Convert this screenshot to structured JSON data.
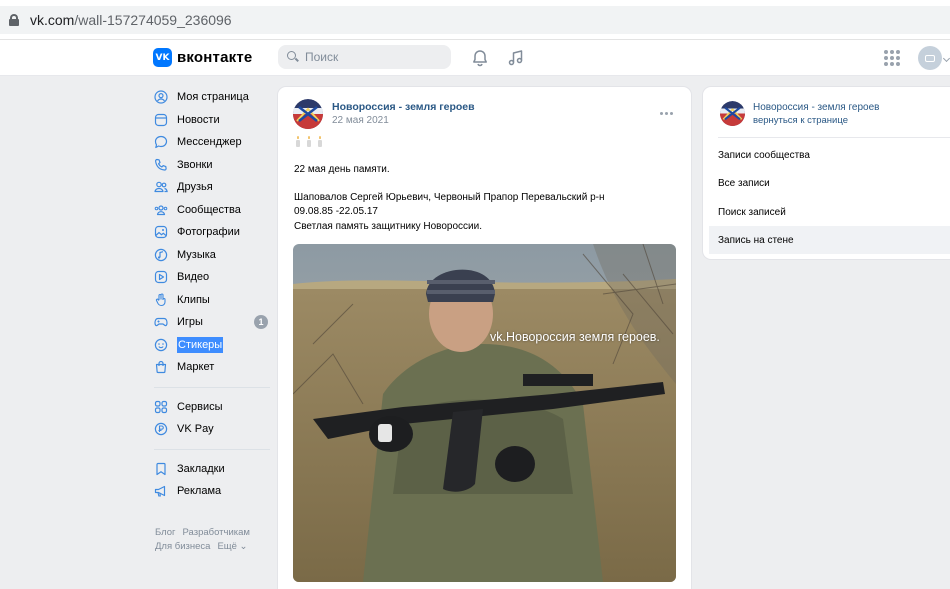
{
  "browser": {
    "url_host": "vk.com",
    "url_path": "/wall-157274059_236096"
  },
  "header": {
    "logo_mark": "VK",
    "logo_text": "вконтакте",
    "search_placeholder": "Поиск"
  },
  "sidebar": {
    "items": [
      {
        "label": "Моя страница",
        "icon": "user-circle-icon"
      },
      {
        "label": "Новости",
        "icon": "news-icon"
      },
      {
        "label": "Мессенджер",
        "icon": "message-icon"
      },
      {
        "label": "Звонки",
        "icon": "phone-icon"
      },
      {
        "label": "Друзья",
        "icon": "friends-icon"
      },
      {
        "label": "Сообщества",
        "icon": "communities-icon"
      },
      {
        "label": "Фотографии",
        "icon": "photo-icon"
      },
      {
        "label": "Музыка",
        "icon": "music-icon"
      },
      {
        "label": "Видео",
        "icon": "video-icon"
      },
      {
        "label": "Клипы",
        "icon": "clips-icon"
      },
      {
        "label": "Игры",
        "icon": "games-icon",
        "badge": "1"
      },
      {
        "label": "Стикеры",
        "icon": "sticker-icon",
        "highlighted": true
      },
      {
        "label": "Маркет",
        "icon": "market-icon"
      }
    ],
    "secondary": [
      {
        "label": "Сервисы",
        "icon": "services-icon"
      },
      {
        "label": "VK Pay",
        "icon": "vkpay-icon"
      }
    ],
    "tertiary": [
      {
        "label": "Закладки",
        "icon": "bookmark-icon"
      },
      {
        "label": "Реклама",
        "icon": "ads-icon"
      }
    ],
    "footer": {
      "blog": "Блог",
      "developers": "Разработчикам",
      "business": "Для бизнеса",
      "more": "Ещё ⌄"
    }
  },
  "post": {
    "author": "Новороссия - земля героев",
    "date": "22 мая 2021",
    "line1": "22 мая день памяти.",
    "line2": "Шаповалов Сергей Юрьевич, Червоный Прапор Перевальский р-н",
    "line3": "09.08.85 -22.05.17",
    "line4": "Светлая память защитнику Новороссии.",
    "photo_watermark": "vk.Новороссия земля героев."
  },
  "right_panel": {
    "title": "Новороссия - земля героев",
    "back": "вернуться к странице",
    "items": [
      {
        "label": "Записи сообщества"
      },
      {
        "label": "Все записи"
      },
      {
        "label": "Поиск записей"
      },
      {
        "label": "Запись на стене",
        "active": true
      }
    ]
  },
  "colors": {
    "accent": "#2a5885",
    "vk_blue": "#0077ff",
    "background": "#edeef0",
    "highlight": "#3e8dff"
  }
}
